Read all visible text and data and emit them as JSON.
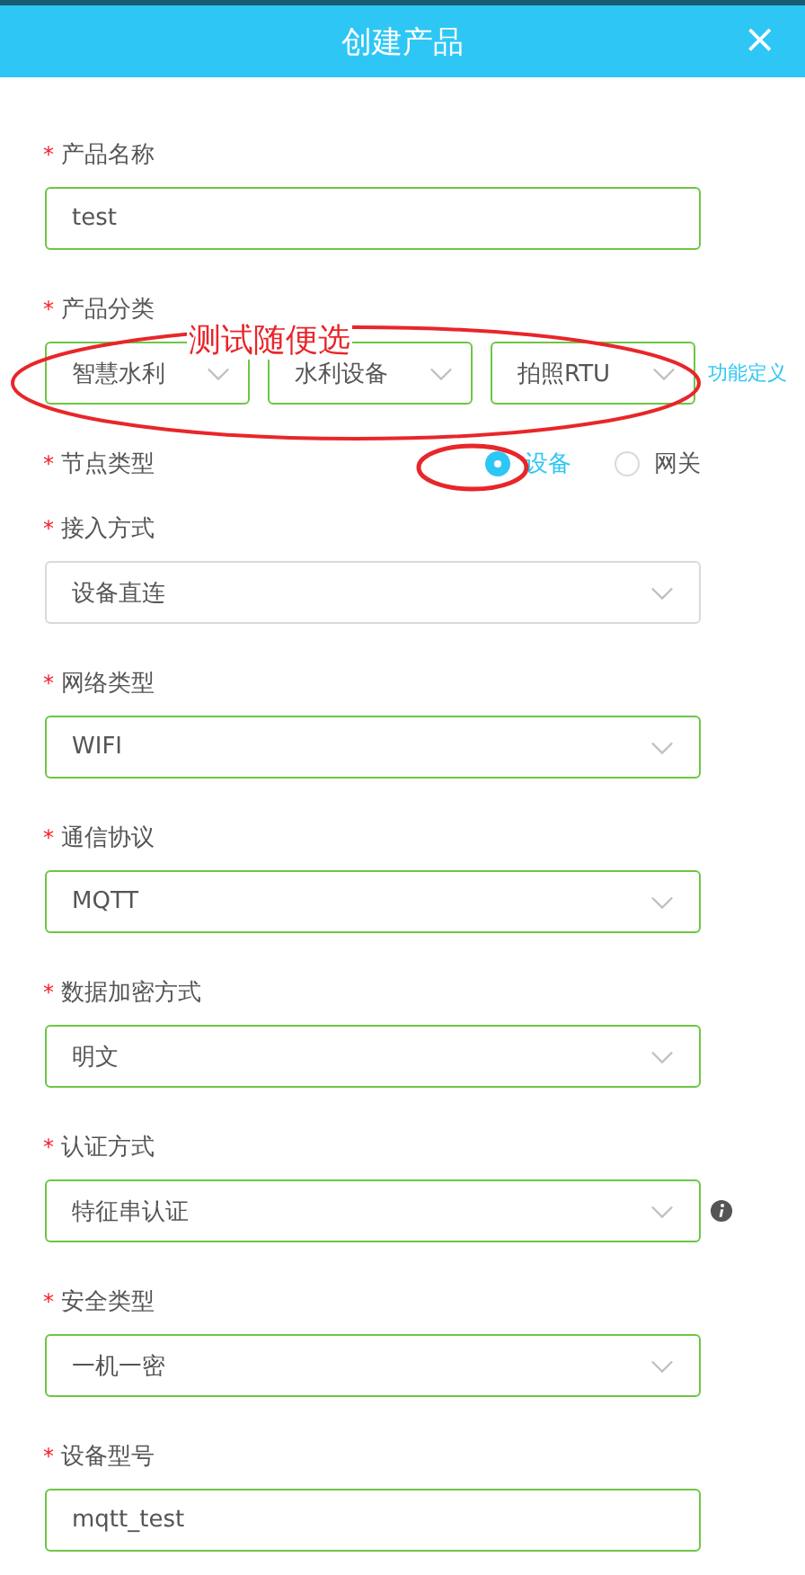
{
  "dialog": {
    "title": "创建产品",
    "close": "×"
  },
  "fields": [
    {
      "kind": "input",
      "mark": "*",
      "label": "产品名称",
      "value": "test"
    },
    {
      "kind": "selects",
      "mark": "*",
      "label": "产品分类",
      "values": [
        "智慧水利",
        "水利设备",
        "拍照RTU"
      ],
      "link": "功能定义"
    },
    {
      "kind": "radio",
      "mark": "*",
      "label": "节点类型",
      "options": [
        {
          "label": "设备",
          "selected": true
        },
        {
          "label": "网关",
          "selected": false
        }
      ]
    },
    {
      "kind": "select",
      "mark": "*",
      "label": "接入方式",
      "value": "设备直连",
      "valid": false
    },
    {
      "kind": "select",
      "mark": "*",
      "label": "网络类型",
      "value": "WIFI",
      "valid": true
    },
    {
      "kind": "select",
      "mark": "*",
      "label": "通信协议",
      "value": "MQTT",
      "valid": true
    },
    {
      "kind": "select",
      "mark": "*",
      "label": "数据加密方式",
      "value": "明文",
      "valid": true
    },
    {
      "kind": "select",
      "mark": "*",
      "label": "认证方式",
      "value": "特征串认证",
      "valid": true,
      "info": true
    },
    {
      "kind": "select",
      "mark": "*",
      "label": "安全类型",
      "value": "一机一密",
      "valid": true
    },
    {
      "kind": "input",
      "mark": "*",
      "label": "设备型号",
      "value": "mqtt_test"
    }
  ],
  "annotation": {
    "text": "测试随便选"
  }
}
